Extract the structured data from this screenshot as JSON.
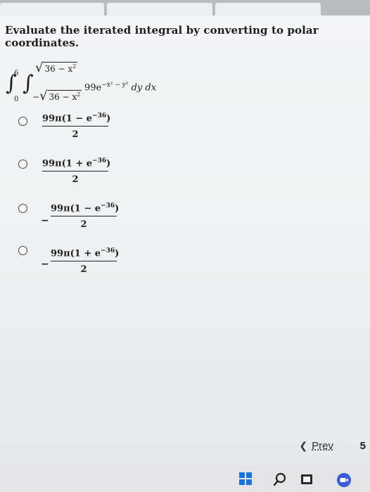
{
  "question": "Evaluate the iterated integral by converting to polar coordinates.",
  "integral": {
    "outer_lower": "0",
    "outer_upper": "6",
    "inner_upper": "36 − x",
    "inner_upper_exp": "2",
    "inner_lower_sign": "−",
    "inner_lower": "36 − x",
    "inner_lower_exp": "2",
    "coefficient": "99e",
    "exponent": "−x² − y²",
    "differentials": "dy dx"
  },
  "options": [
    {
      "sign": "",
      "numerator_lead": "99π(1 − e",
      "numerator_exp": "−36",
      "numerator_tail": ")",
      "denominator": "2"
    },
    {
      "sign": "",
      "numerator_lead": "99π(1 + e",
      "numerator_exp": "−36",
      "numerator_tail": ")",
      "denominator": "2"
    },
    {
      "sign": "−",
      "numerator_lead": "99π(1 − e",
      "numerator_exp": "−36",
      "numerator_tail": ")",
      "denominator": "2"
    },
    {
      "sign": "−",
      "numerator_lead": "99π(1 + e",
      "numerator_exp": "−36",
      "numerator_tail": ")",
      "denominator": "2"
    }
  ],
  "navigation": {
    "prev_label": "Prev",
    "prev_icon": "chevron-left-icon",
    "page_number": "5"
  },
  "taskbar": {
    "icons": [
      "windows-start-icon",
      "search-icon",
      "file-explorer-icon",
      "camera-icon"
    ]
  }
}
